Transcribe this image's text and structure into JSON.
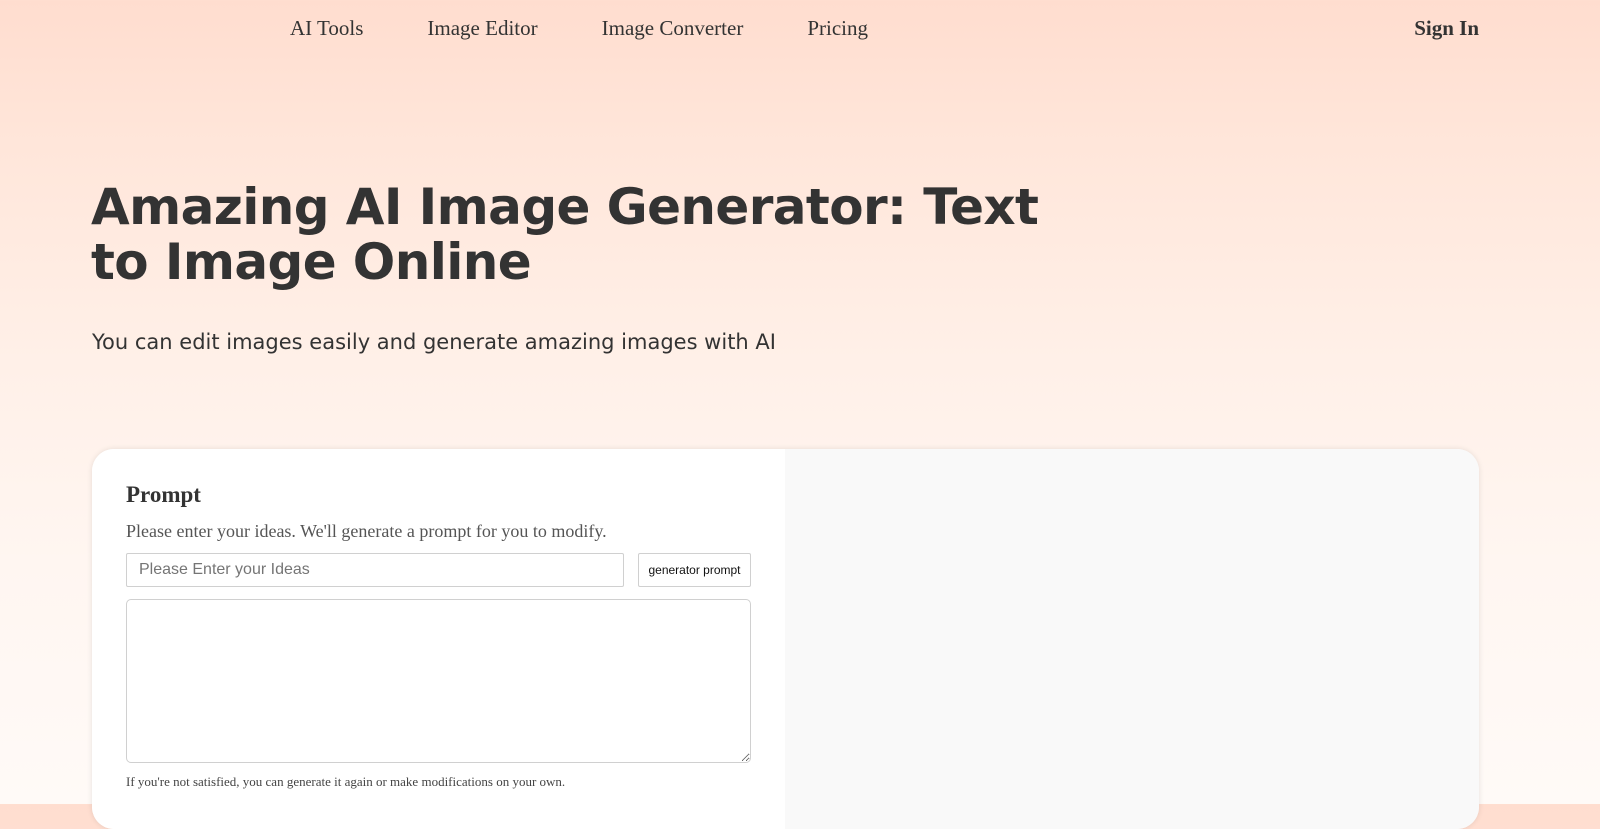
{
  "nav": {
    "links": [
      {
        "label": "AI Tools"
      },
      {
        "label": "Image Editor"
      },
      {
        "label": "Image Converter"
      },
      {
        "label": "Pricing"
      }
    ],
    "sign_in": "Sign In"
  },
  "hero": {
    "title": "Amazing AI Image Generator: Text to Image Online",
    "subtitle": "You can edit images easily and generate amazing images with AI"
  },
  "prompt": {
    "heading": "Prompt",
    "description": "Please enter your ideas. We'll generate a prompt for you to modify.",
    "ideas_input_value": "",
    "ideas_placeholder": "Please Enter your Ideas",
    "generator_button": "generator prompt",
    "prompt_text": "",
    "hint": "If you're not satisfied, you can generate it again or make modifications on your own."
  },
  "colors": {
    "text": "#333333",
    "gradient_top": "#ffddcf",
    "gradient_bottom": "#fffaf7",
    "card_background": "#ffffff",
    "preview_background": "#f9f9f9",
    "border": "#d0d0d0"
  }
}
